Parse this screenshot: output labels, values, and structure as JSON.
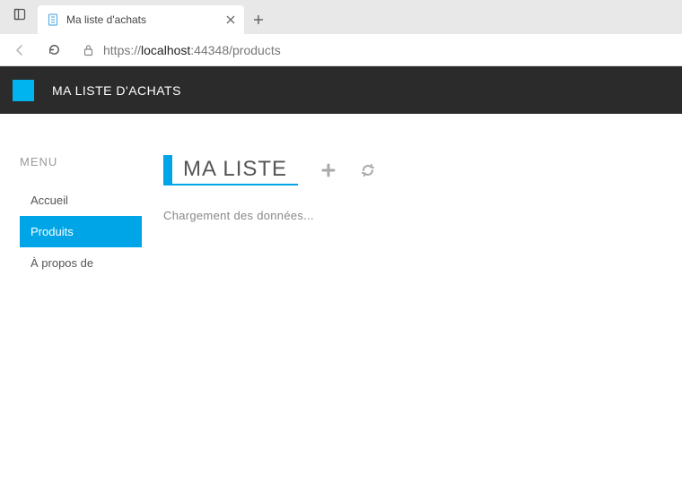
{
  "browser": {
    "tab_title": "Ma liste d'achats",
    "url_prefix": "https://",
    "url_host": "localhost",
    "url_port_path": ":44348/products"
  },
  "app": {
    "title": "MA LISTE D'ACHATS"
  },
  "sidebar": {
    "label": "MENU",
    "items": [
      {
        "label": "Accueil",
        "active": false
      },
      {
        "label": "Produits",
        "active": true
      },
      {
        "label": "À propos de",
        "active": false
      }
    ]
  },
  "main": {
    "title": "MA LISTE",
    "loading_text": "Chargement des données...",
    "actions": {
      "add": "plus-icon",
      "refresh": "refresh-icon"
    }
  },
  "colors": {
    "accent": "#00a5e8",
    "header_bg": "#2b2b2b"
  }
}
